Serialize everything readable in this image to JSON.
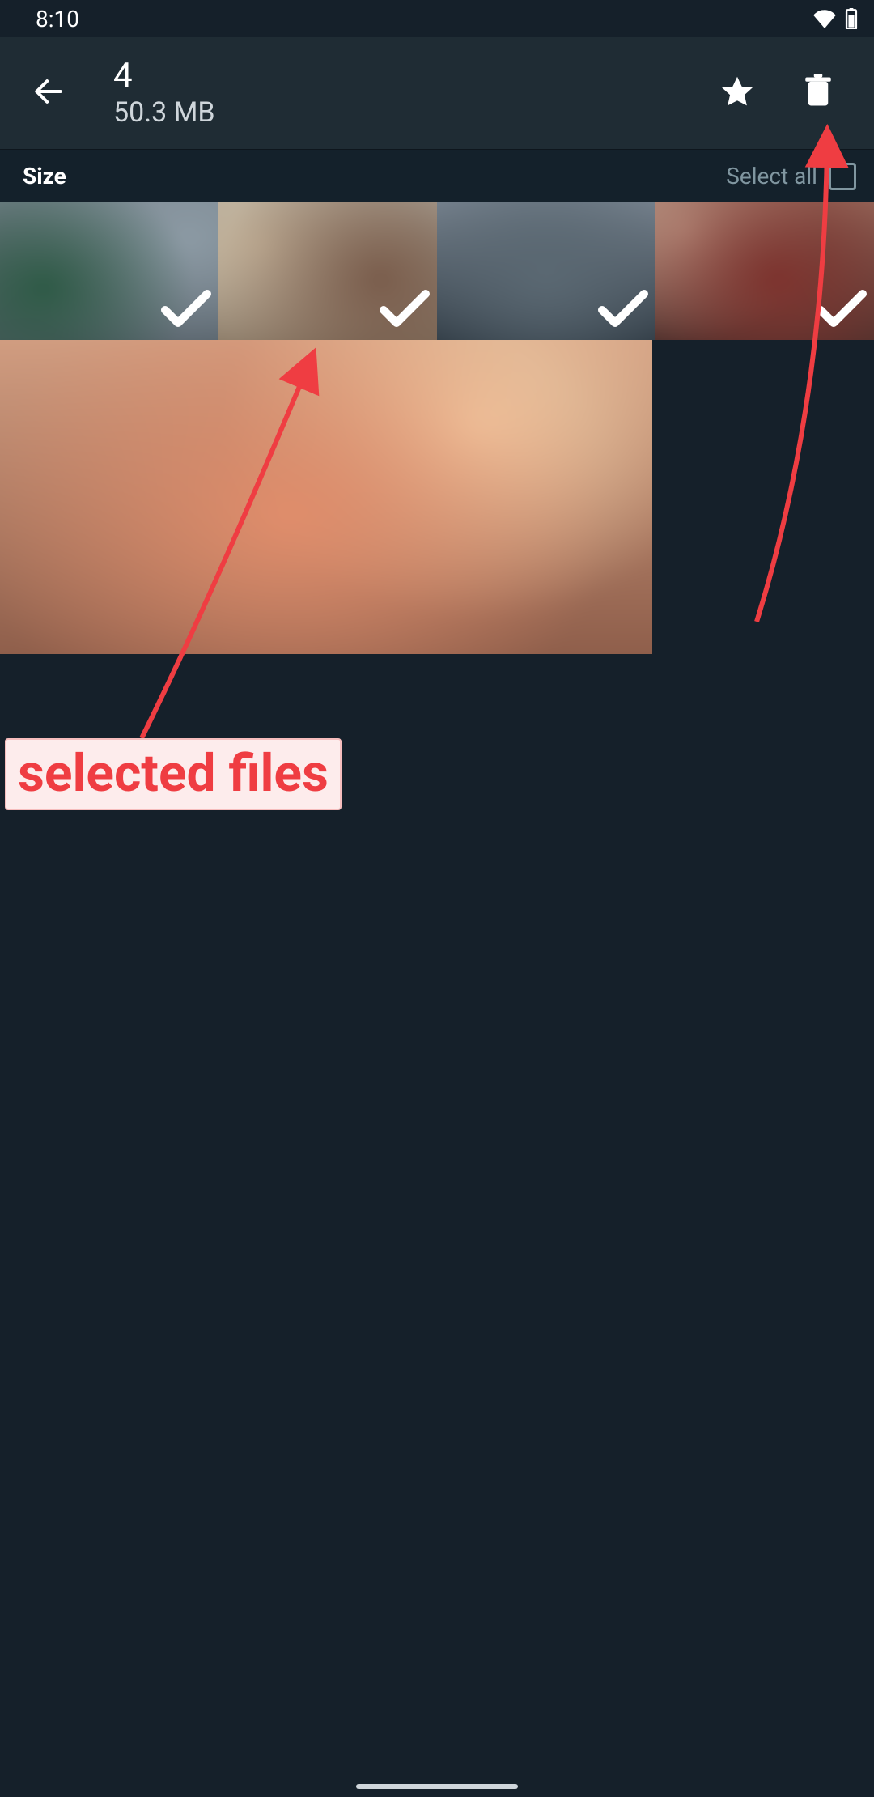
{
  "status": {
    "time": "8:10"
  },
  "header": {
    "count": "4",
    "size": "50.3 MB"
  },
  "row2": {
    "sort": "Size",
    "select_all": "Select all"
  },
  "thumbs": [
    {
      "selected": true
    },
    {
      "selected": true
    },
    {
      "selected": true
    },
    {
      "selected": true
    },
    {
      "selected": false
    }
  ],
  "annotation": {
    "label": "selected files"
  }
}
